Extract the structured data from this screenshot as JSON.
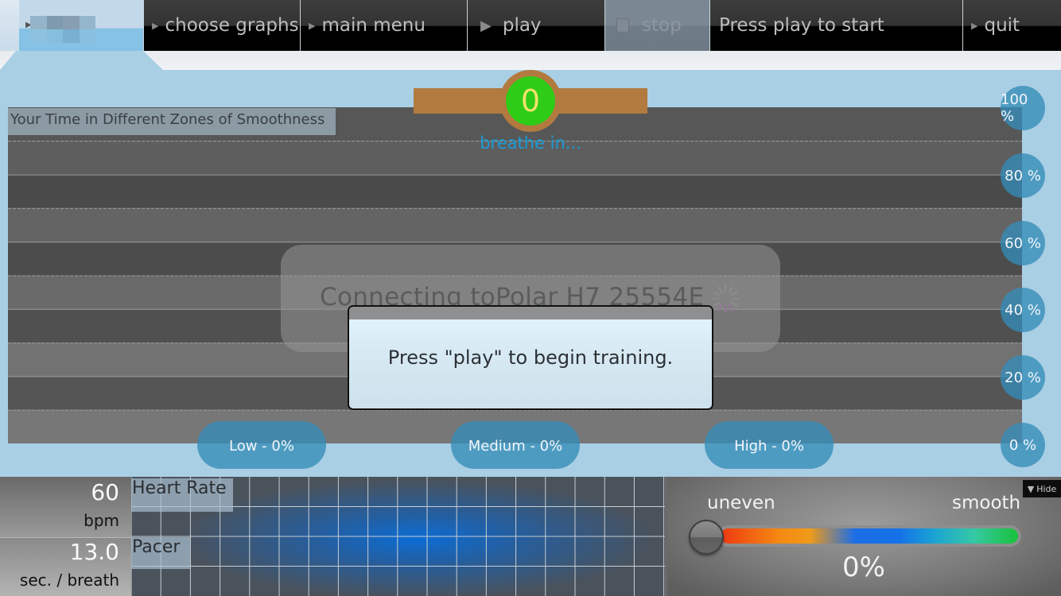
{
  "toolbar": {
    "logo_label": "",
    "buttons": [
      {
        "id": "choose-graphs",
        "label": "choose graphs",
        "icon": "triangle-right-icon"
      },
      {
        "id": "main-menu",
        "label": "main menu",
        "icon": "triangle-right-icon"
      },
      {
        "id": "play",
        "label": "play",
        "icon": "play-icon"
      },
      {
        "id": "stop",
        "label": "stop",
        "icon": "stop-icon",
        "disabled": true
      },
      {
        "id": "quit",
        "label": "quit",
        "icon": "triangle-right-icon"
      }
    ],
    "status": "Press play to start"
  },
  "pacer": {
    "count": "0",
    "instruction": "breathe in...",
    "colors": {
      "bar": "#b27a3f",
      "ball": "#2ecc17",
      "digit": "#f1e36a",
      "text": "#1a9cd6"
    }
  },
  "zones_chart": {
    "title": "Your Time in Different Zones of Smoothness",
    "axis_labels": [
      "100 %",
      "80 %",
      "60 %",
      "40 %",
      "20 %",
      "0 %"
    ],
    "zones": [
      {
        "name": "Low",
        "label": "Low - 0%",
        "value": 0
      },
      {
        "name": "Medium",
        "label": "Medium - 0%",
        "value": 0
      },
      {
        "name": "High",
        "label": "High - 0%",
        "value": 0
      }
    ]
  },
  "connection": {
    "message": "Connecting toPolar H7 25554E"
  },
  "dialog": {
    "message": "Press \"play\" to begin training."
  },
  "readouts": {
    "heart_rate": {
      "value": "60",
      "unit": "bpm",
      "graph_label": "Heart Rate"
    },
    "pacer": {
      "value": "13.0",
      "unit": "sec. / breath",
      "graph_label": "Pacer"
    }
  },
  "smoothness": {
    "left_label": "uneven",
    "right_label": "smooth",
    "value_label": "0%",
    "value": 0,
    "hide_label": "Hide"
  }
}
